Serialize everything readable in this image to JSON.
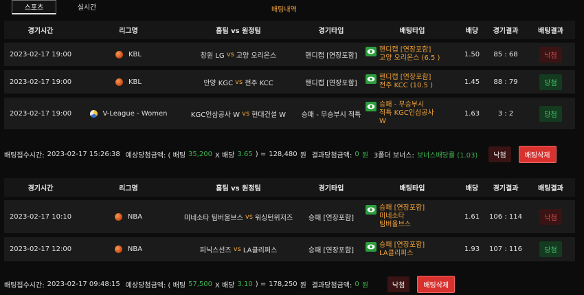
{
  "tabs": [
    {
      "label": "스포츠",
      "active": true
    },
    {
      "label": "실시간",
      "active": false
    }
  ],
  "page_title": "배팅내역",
  "headers": {
    "time": "경기시간",
    "league": "리그명",
    "match": "홈팀 vs 원정팀",
    "game_type": "경기타입",
    "bet_type": "배팅타입",
    "odds": "배당",
    "score": "경기결과",
    "result": "배팅결과"
  },
  "vs": "vs",
  "slips": [
    {
      "rows": [
        {
          "time": "2023-02-17 19:00",
          "league": "KBL",
          "icon": "basketball-icon",
          "home": "창원 LG",
          "away": "고양 오리온스",
          "game_type": "핸디캡 [연장포함]",
          "bet_line1": "핸디캡 [연장포함]",
          "bet_line2": "고양 오리온스 (6.5 )",
          "bet_line3": "",
          "odds": "1.50",
          "score": "85 : 68",
          "result": "낙첨",
          "result_kind": "lose"
        },
        {
          "time": "2023-02-17 19:00",
          "league": "KBL",
          "icon": "basketball-icon",
          "home": "안양 KGC",
          "away": "전주 KCC",
          "game_type": "핸디캡 [연장포함]",
          "bet_line1": "핸디캡 [연장포함]",
          "bet_line2": "전주 KCC (10.5 )",
          "bet_line3": "",
          "odds": "1.45",
          "score": "88 : 79",
          "result": "당첨",
          "result_kind": "win"
        },
        {
          "time": "2023-02-17 19:00",
          "league": "V-League - Women",
          "icon": "volleyball-icon",
          "home": "KGC인삼공사 W",
          "away": "현대건설 W",
          "game_type": "승패 - 무승부시 적특",
          "bet_line1": "승패 - 무승부시",
          "bet_line2": "적특 KGC인삼공사",
          "bet_line3": "W",
          "odds": "1.63",
          "score": "3 : 2",
          "result": "당첨",
          "result_kind": "win"
        }
      ],
      "summary": {
        "label": "배팅접수시간:",
        "received": "2023-02-17 15:26:38",
        "expected_label": "예상당첨금액: ( 배팅",
        "stake": "35,200",
        "x_odds": "X 배당",
        "odds": "3.65",
        "eq": ") =",
        "expected": "128,480",
        "won": "원",
        "result_label": "결과당첨금액:",
        "result_amount": "0",
        "won2": "원",
        "bonus_label": "3폴더 보너스:",
        "bonus_value": "보너스배당률 (1.03)",
        "status": "낙첨",
        "delete": "배팅삭제"
      }
    },
    {
      "rows": [
        {
          "time": "2023-02-17 10:10",
          "league": "NBA",
          "icon": "basketball-icon",
          "home": "미네소타 팀버울브스",
          "away": "워싱턴위저즈",
          "game_type": "승패 [연장포함]",
          "bet_line1": "승패 [연장포함]",
          "bet_line2": "미네소타",
          "bet_line3": "팀버울브스",
          "odds": "1.61",
          "score": "106 : 114",
          "result": "낙첨",
          "result_kind": "lose"
        },
        {
          "time": "2023-02-17 12:00",
          "league": "NBA",
          "icon": "basketball-icon",
          "home": "피닉스선즈",
          "away": "LA클리퍼스",
          "game_type": "승패 [연장포함]",
          "bet_line1": "승패 [연장포함]",
          "bet_line2": "LA클리퍼스",
          "bet_line3": "",
          "odds": "1.93",
          "score": "107 : 116",
          "result": "당첨",
          "result_kind": "win"
        }
      ],
      "summary": {
        "label": "배팅접수시간:",
        "received": "2023-02-17 09:48:15",
        "expected_label": "예상당첨금액: ( 배팅",
        "stake": "57,500",
        "x_odds": "X 배당",
        "odds": "3.10",
        "eq": ") =",
        "expected": "178,250",
        "won": "원",
        "result_label": "결과당첨금액:",
        "result_amount": "0",
        "won2": "원",
        "status": "낙첨",
        "delete": "배팅삭제"
      }
    }
  ]
}
